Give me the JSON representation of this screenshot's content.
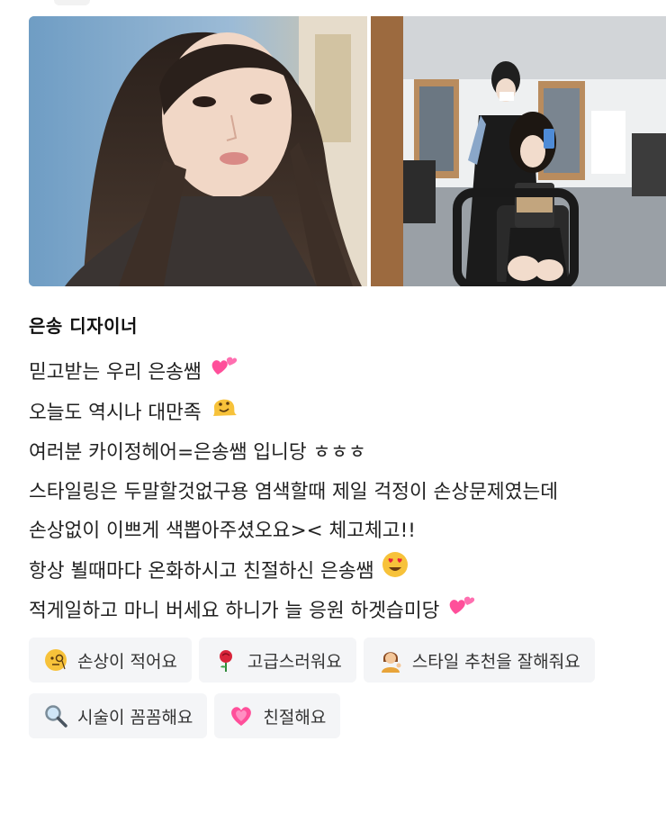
{
  "review": {
    "reviewer": "은송 디자이너",
    "lines": [
      {
        "text": "믿고받는 우리 은송쌤",
        "emoji": "two-hearts-icon"
      },
      {
        "text": "오늘도 역시나 대만족",
        "emoji": "melting-face-icon"
      },
      {
        "text": "여러분 카이정헤어=은송쌤 입니당 ㅎㅎㅎ",
        "emoji": ""
      },
      {
        "text": "스타일링은 두말할것없구용 염색할때 제일 걱정이 손상문제였는데",
        "emoji": ""
      },
      {
        "text": "손상없이 이쁘게 색뽑아주셨오요>< 체고체고!!",
        "emoji": ""
      },
      {
        "text": "항상 뵐때마다 온화하시고 친절하신 은송쌤",
        "emoji": "heart-eyes-icon"
      },
      {
        "text": "적게일하고 마니 버세요 하니가 늘 응원 하겟습미당",
        "emoji": "two-hearts-icon"
      }
    ]
  },
  "tags": [
    {
      "label": "손상이 적어요",
      "icon": "face-with-monocle-icon"
    },
    {
      "label": "고급스러워요",
      "icon": "rose-icon"
    },
    {
      "label": "스타일 추천을 잘해줘요",
      "icon": "person-tipping-hand-icon"
    },
    {
      "label": "시술이 꼼꼼해요",
      "icon": "magnifying-glass-icon"
    },
    {
      "label": "친절해요",
      "icon": "growing-heart-icon"
    }
  ],
  "colors": {
    "text": "#222222",
    "tag_bg": "#f4f5f7",
    "heart_pink": "#ff4f9a",
    "emoji_yellow": "#f7c23a"
  }
}
